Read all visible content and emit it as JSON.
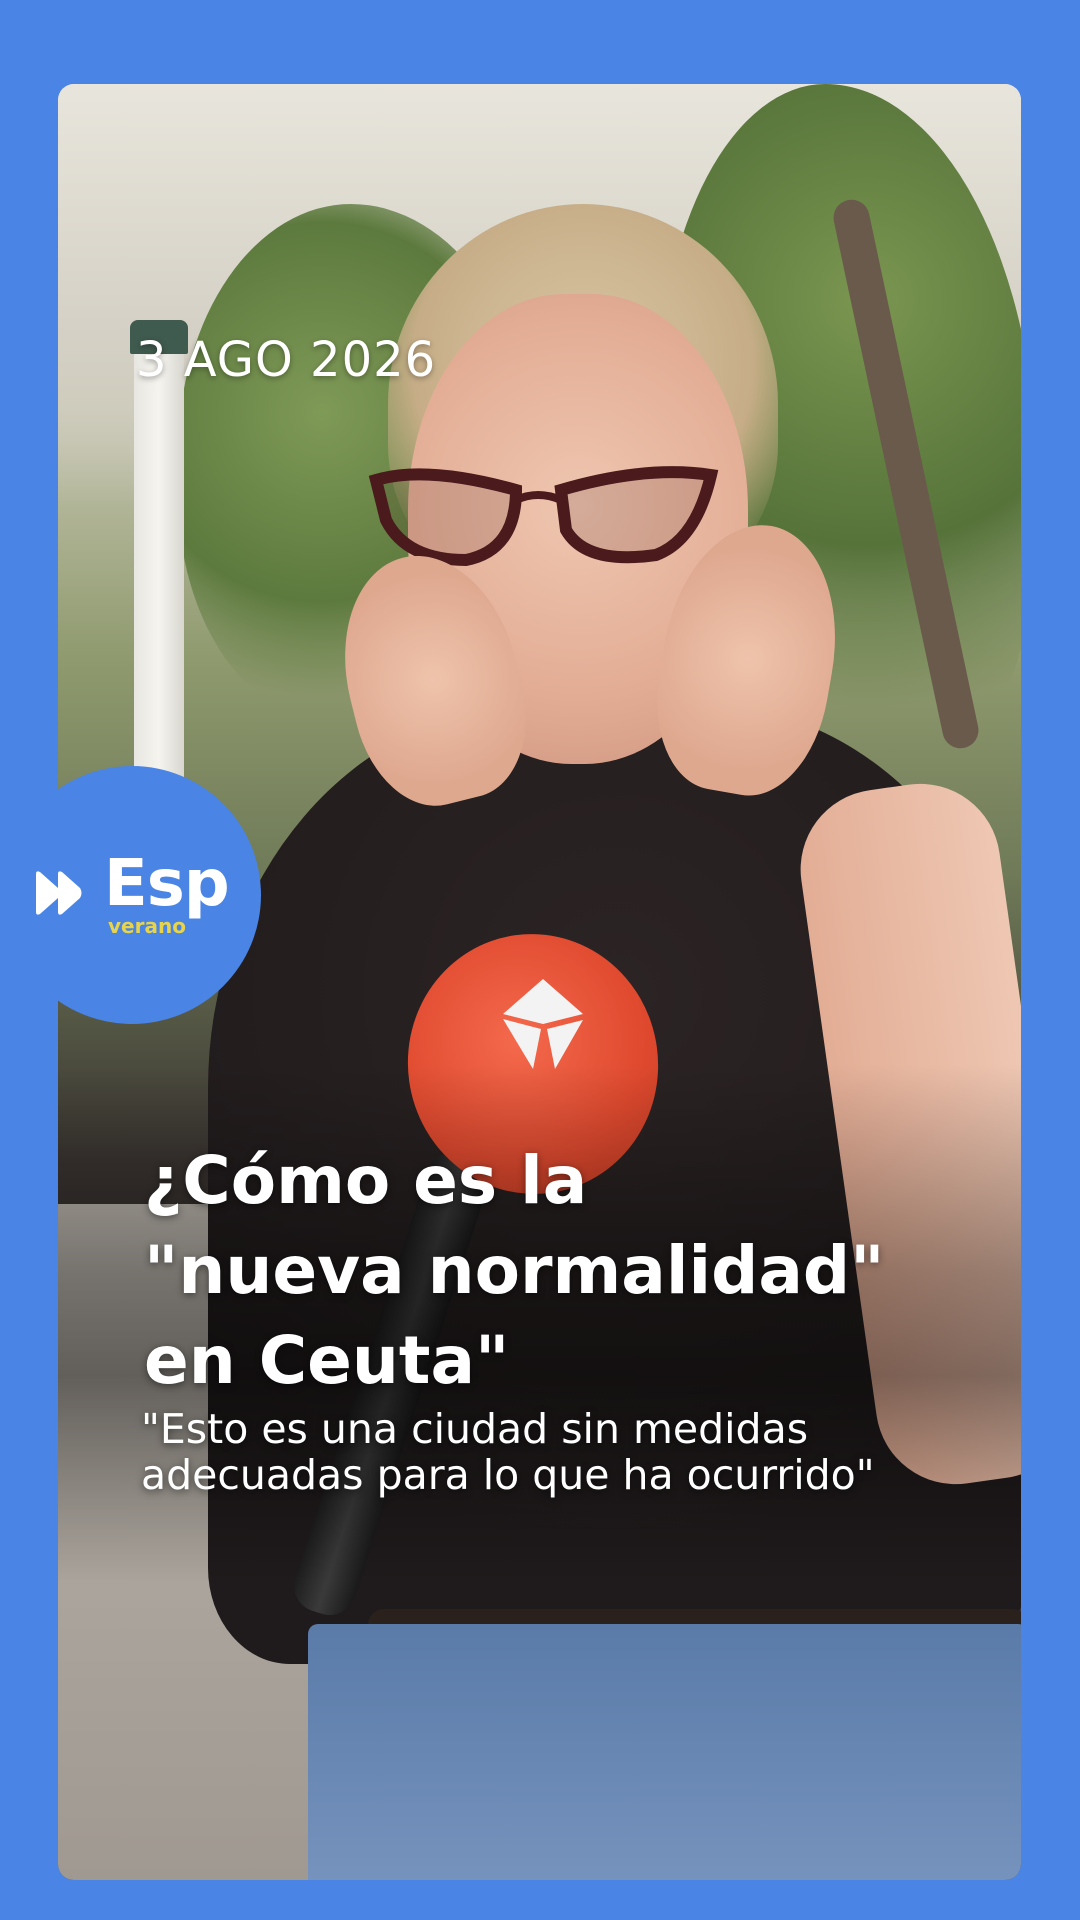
{
  "story": {
    "date": "3 AGO 2026",
    "headline_lines": [
      "¿Cómo es la",
      "\"nueva normalidad\"",
      "en Ceuta\""
    ],
    "quote_lines": [
      "\"Esto es una ciudad sin medidas",
      "adecuadas para lo que ha ocurrido\""
    ]
  },
  "brand": {
    "name": "Esp",
    "subtitle": "verano",
    "icon": "double-play-icon",
    "circle_color": "#4a84e4",
    "subtitle_color": "#e8d44a"
  },
  "theme": {
    "background": "#4a84e4",
    "text": "#ffffff"
  }
}
